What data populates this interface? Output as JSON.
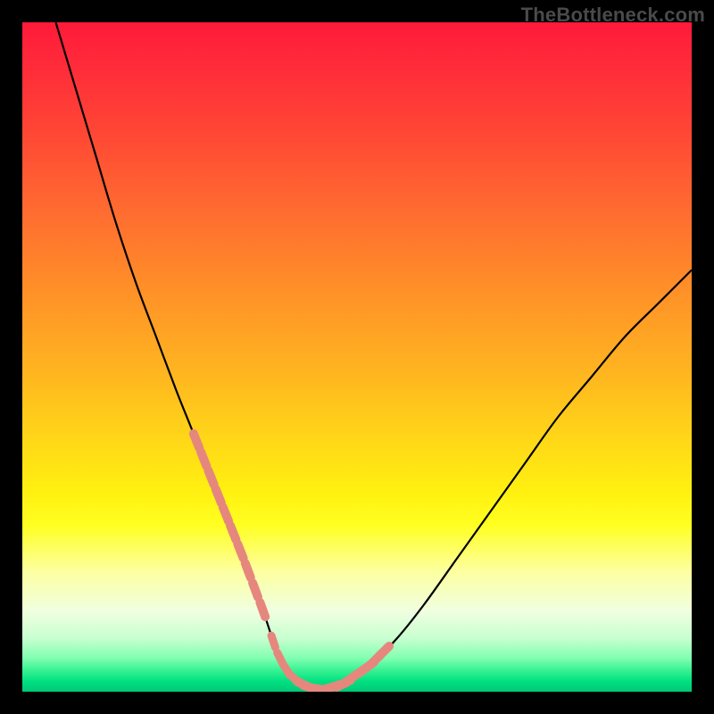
{
  "watermark": "TheBottleneck.com",
  "colors": {
    "curve": "#000000",
    "tick": "#e6877e",
    "frame": "#000000"
  },
  "chart_data": {
    "type": "line",
    "title": "",
    "xlabel": "",
    "ylabel": "",
    "xlim": [
      0,
      100
    ],
    "ylim": [
      0,
      100
    ],
    "grid": false,
    "legend": false,
    "series": [
      {
        "name": "bottleneck-curve",
        "x": [
          5,
          8,
          11,
          14,
          17,
          20,
          23,
          25,
          27,
          29,
          31,
          33,
          34.5,
          36,
          37,
          38,
          39,
          40,
          41.5,
          43,
          45,
          48,
          52,
          56,
          60,
          65,
          70,
          75,
          80,
          85,
          90,
          95,
          100
        ],
        "y": [
          100,
          90,
          80,
          70,
          61,
          53,
          45,
          40,
          35,
          30,
          25,
          20,
          16,
          12,
          9,
          6,
          4,
          2.5,
          1.3,
          0.6,
          0.3,
          1.2,
          4,
          8,
          13,
          20,
          27,
          34,
          41,
          47,
          53,
          58,
          63
        ]
      }
    ],
    "annotations": {
      "tick_marks": {
        "description": "Short pink segments overlaid on the curve near the valley region",
        "color": "#e6877e",
        "segments_x_ranges": [
          [
            26,
            36.5
          ],
          [
            42,
            55
          ]
        ]
      }
    }
  }
}
